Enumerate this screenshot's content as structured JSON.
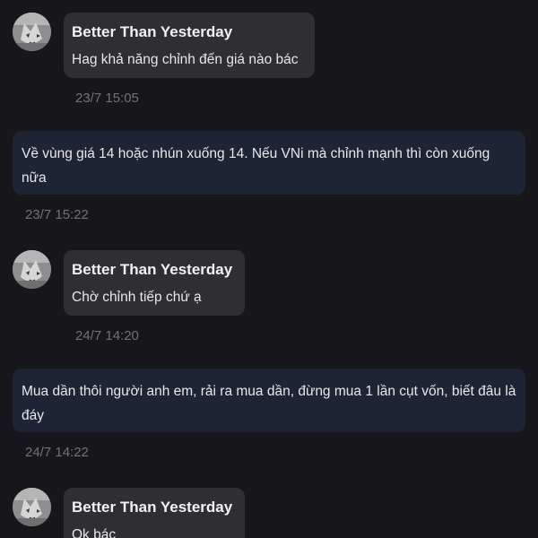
{
  "messages": [
    {
      "sender": "Better Than Yesterday",
      "text": "Hag khả năng chỉnh đến giá nào bác",
      "time": "23/7 15:05"
    },
    {
      "text": "Về vùng giá 14 hoặc nhún xuống 14. Nếu VNi mà chỉnh mạnh thì còn xuống nữa",
      "time": "23/7 15:22"
    },
    {
      "sender": "Better Than Yesterday",
      "text": "Chờ chỉnh tiếp chứ ạ",
      "time": "24/7 14:20"
    },
    {
      "text": "Mua dần thôi người anh em, rải ra mua dần, đừng mua 1 lần cụt vốn, biết đâu là đáy",
      "time": "24/7 14:22"
    },
    {
      "sender": "Better Than Yesterday",
      "text": "Ok bác"
    }
  ],
  "avatar_icon": "wolf-avatar-icon",
  "colors": {
    "background": "#17171b",
    "incoming_bubble": "#2e2e33",
    "outgoing_bubble": "#1d2433",
    "timestamp": "#6f727a"
  }
}
